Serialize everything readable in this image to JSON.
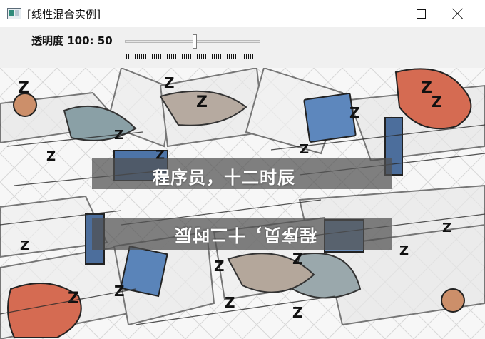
{
  "window": {
    "title": "[线性混合实例]"
  },
  "controls": {
    "trackbar_label": "透明度 100: 50",
    "trackbar_value": 50,
    "trackbar_max": 100
  },
  "image": {
    "banner_top_text": "程序员，十二时辰",
    "banner_bottom_text": "程序员，十二时辰"
  },
  "icons": {
    "app": "app-icon",
    "minimize": "minimize-icon",
    "maximize": "maximize-icon",
    "close": "close-icon"
  },
  "colors": {
    "titlebar": "#ffffff",
    "window_bg": "#f0f0f0",
    "banner": "#505050",
    "accent_red": "#d56b52",
    "monitor_blue": "#4f78ad"
  }
}
